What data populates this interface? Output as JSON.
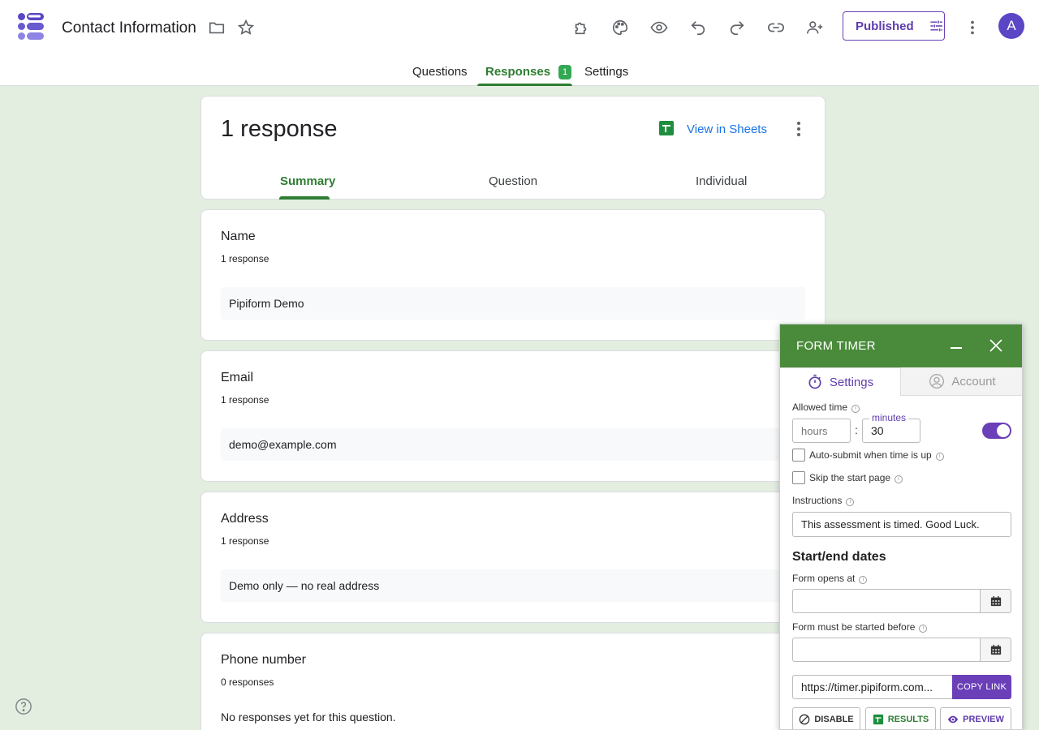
{
  "app": {
    "title": "Contact Information",
    "avatar_letter": "A",
    "published_label": "Published"
  },
  "header_icons": [
    "folder-icon",
    "star-icon",
    "addons-icon",
    "palette-icon",
    "preview-eye-icon",
    "undo-icon",
    "redo-icon",
    "link-icon",
    "add-collaborator-icon",
    "more-vert-icon"
  ],
  "tabs": [
    {
      "label": "Questions",
      "active": false
    },
    {
      "label": "Responses",
      "active": true,
      "badge": "1"
    },
    {
      "label": "Settings",
      "active": false
    }
  ],
  "summary": {
    "count_label": "1 response",
    "view_in_sheets": "View in Sheets",
    "subtabs": [
      {
        "label": "Summary",
        "active": true
      },
      {
        "label": "Question",
        "active": false
      },
      {
        "label": "Individual",
        "active": false
      }
    ]
  },
  "questions": [
    {
      "title": "Name",
      "count": "1 response",
      "answer": "Pipiform Demo"
    },
    {
      "title": "Email",
      "count": "1 response",
      "answer": "demo@example.com"
    },
    {
      "title": "Address",
      "count": "1 response",
      "answer": "Demo only — no real address"
    },
    {
      "title": "Phone number",
      "count": "0 responses",
      "empty_text": "No responses yet for this question."
    }
  ],
  "timer": {
    "title": "FORM TIMER",
    "tab_settings": "Settings",
    "tab_account": "Account",
    "allowed_time_label": "Allowed time",
    "hours_placeholder": "hours",
    "minutes_label": "minutes",
    "minutes_value": "30",
    "timer_enabled": true,
    "auto_submit_label": "Auto-submit when time is up",
    "auto_submit_checked": false,
    "skip_start_label": "Skip the start page",
    "skip_start_checked": false,
    "instructions_label": "Instructions",
    "instructions_value": "This assessment is timed. Good Luck.",
    "dates_heading": "Start/end dates",
    "opens_label": "Form opens at",
    "opens_value": "",
    "started_before_label": "Form must be started before",
    "started_before_value": "",
    "link_value": "https://timer.pipiform.com...",
    "copy_link": "COPY LINK",
    "disable": "DISABLE",
    "results": "RESULTS",
    "preview": "PREVIEW"
  },
  "colors": {
    "green_accent": "#2e7d32",
    "purple_accent": "#6a3fb8",
    "timer_header": "#4a8b3b",
    "page_bg": "#e3eee1"
  }
}
